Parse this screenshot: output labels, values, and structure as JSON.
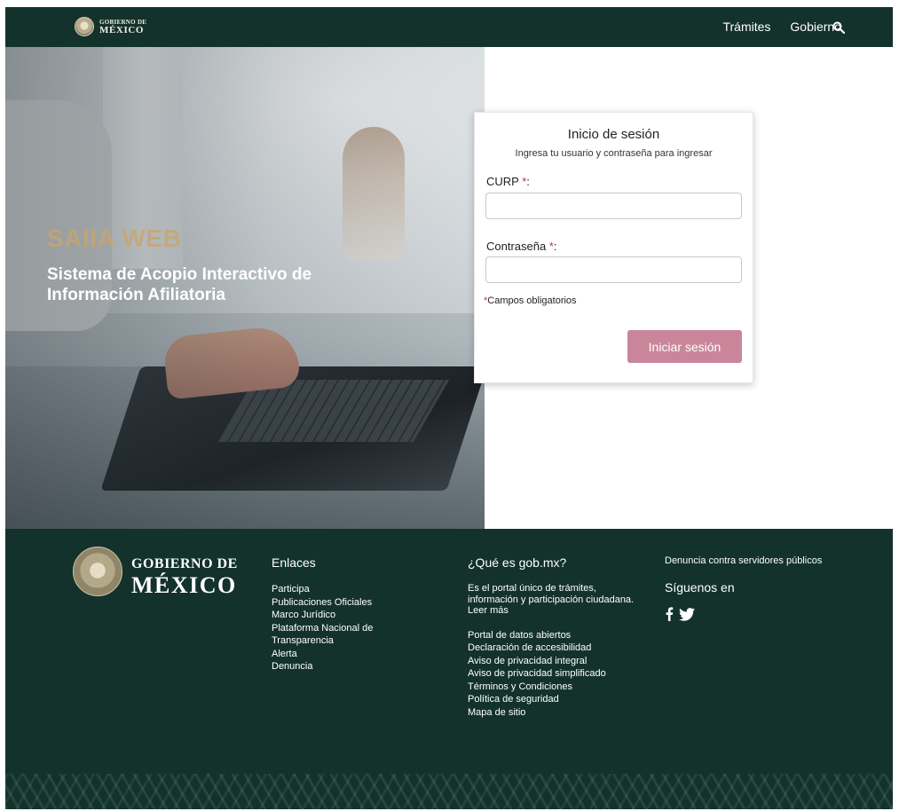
{
  "header": {
    "brand_line1": "GOBIERNO DE",
    "brand_line2": "MÉXICO",
    "nav": [
      "Trámites",
      "Gobierno"
    ]
  },
  "hero": {
    "title": "SAIIA WEB",
    "subtitle": "Sistema de Acopio Interactivo de Información Afiliatoria"
  },
  "login": {
    "title": "Inicio de sesión",
    "subtitle": "Ingresa tu usuario y contraseña para ingresar",
    "curp_label": "CURP",
    "password_label": "Contraseña",
    "required_mark": "*",
    "label_suffix": ":",
    "required_note": "Campos obligatorios",
    "submit": "Iniciar sesión"
  },
  "footer": {
    "brand_line1": "GOBIERNO DE",
    "brand_line2": "MÉXICO",
    "links_heading": "Enlaces",
    "links": [
      "Participa",
      "Publicaciones Oficiales",
      "Marco Jurídico",
      "Plataforma Nacional de Transparencia",
      "Alerta",
      "Denuncia"
    ],
    "about_heading": "¿Qué es gob.mx?",
    "about_text": "Es el portal único de trámites, información y participación ciudadana. Leer más",
    "about_links": [
      "Portal de datos abiertos",
      "Declaración de accesibilidad",
      "Aviso de privacidad integral",
      "Aviso de privacidad simplificado",
      "Términos y Condiciones",
      "Política de seguridad",
      "Mapa de sitio"
    ],
    "denuncia": "Denuncia contra servidores públicos",
    "siguenos": "Síguenos en"
  },
  "colors": {
    "dark_green": "#13322b",
    "button_pink": "#c9869b",
    "gold": "#c9a56a"
  }
}
